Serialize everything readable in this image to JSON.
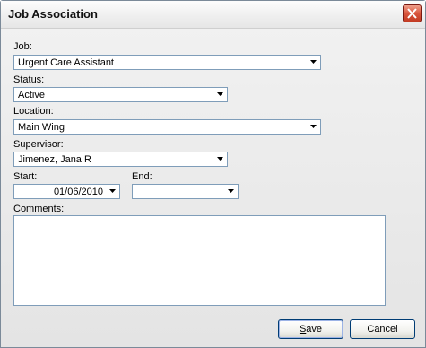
{
  "window": {
    "title": "Job Association"
  },
  "icons": {
    "close": "close-icon",
    "dropdown": "chevron-down-icon"
  },
  "form": {
    "job": {
      "label": "Job:",
      "value": "Urgent Care Assistant"
    },
    "status": {
      "label": "Status:",
      "value": "Active"
    },
    "location": {
      "label": "Location:",
      "value": "Main Wing"
    },
    "supervisor": {
      "label": "Supervisor:",
      "value": "Jimenez, Jana R"
    },
    "start": {
      "label": "Start:",
      "value": "01/06/2010"
    },
    "end": {
      "label": "End:",
      "value": ""
    },
    "comments": {
      "label": "Comments:",
      "value": ""
    }
  },
  "buttons": {
    "save": {
      "mnemonic": "S",
      "rest": "ave"
    },
    "cancel": "Cancel"
  }
}
